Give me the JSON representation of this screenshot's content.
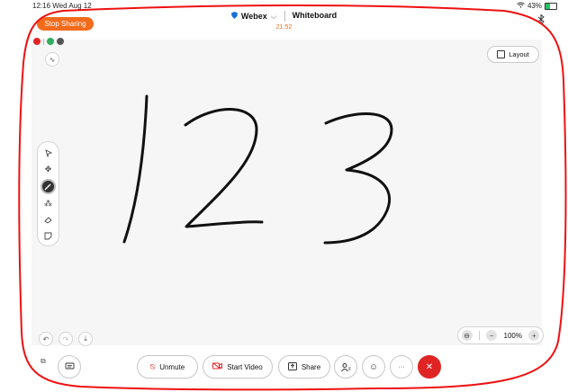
{
  "status_bar": {
    "time_date": "12:16  Wed Aug 12",
    "battery": "43%"
  },
  "stop_sharing": {
    "label": "Stop Sharing"
  },
  "header": {
    "brand": "Webex",
    "title": "Whiteboard",
    "timer": "21:52"
  },
  "layout_button": {
    "label": "Layout"
  },
  "whiteboard": {
    "drawn_text": "123"
  },
  "zoom": {
    "level": "100%"
  },
  "controls": {
    "unmute": "Unmute",
    "start_video": "Start Video",
    "share": "Share",
    "more": "···"
  },
  "colors": {
    "accent_orange": "#f26b1d",
    "end_call_red": "#e02424",
    "annotation_red": "#e11"
  }
}
